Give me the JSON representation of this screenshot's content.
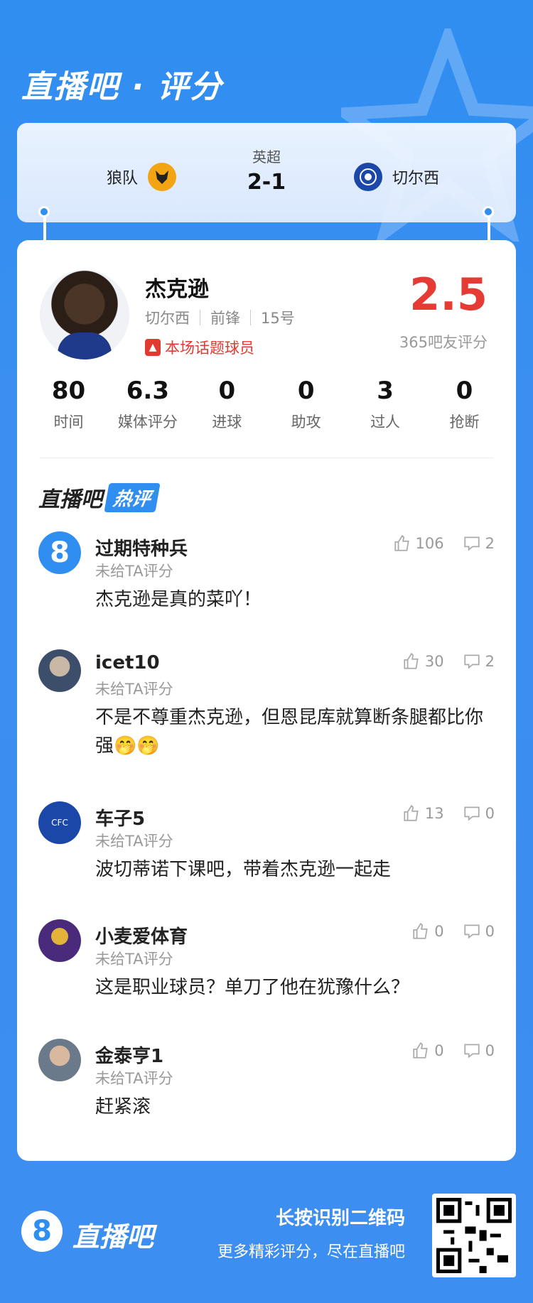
{
  "header": {
    "title": "直播吧 · 评分"
  },
  "match": {
    "league": "英超",
    "score": "2-1",
    "home": "狼队",
    "away": "切尔西",
    "home_badge": "wolves-badge-icon",
    "away_badge": "chelsea-badge-icon"
  },
  "player": {
    "name": "杰克逊",
    "club": "切尔西",
    "position": "前锋",
    "number": "15号",
    "tag": "本场话题球员",
    "rating": "2.5",
    "rating_label": "365吧友评分"
  },
  "stats": [
    {
      "value": "80",
      "label": "时间"
    },
    {
      "value": "6.3",
      "label": "媒体评分"
    },
    {
      "value": "0",
      "label": "进球"
    },
    {
      "value": "0",
      "label": "助攻"
    },
    {
      "value": "3",
      "label": "过人"
    },
    {
      "value": "0",
      "label": "抢断"
    }
  ],
  "hot_section": {
    "brand": "直播吧",
    "pill": "热评"
  },
  "comments": [
    {
      "user": "过期特种兵",
      "sub": "未给TA评分",
      "text": "杰克逊是真的菜吖！",
      "likes": "106",
      "replies": "2"
    },
    {
      "user": "icet10",
      "sub": "未给TA评分",
      "text": "不是不尊重杰克逊，但恩昆库就算断条腿都比你强🤭🤭",
      "likes": "30",
      "replies": "2"
    },
    {
      "user": "车子5",
      "sub": "未给TA评分",
      "text": "波切蒂诺下课吧，带着杰克逊一起走",
      "likes": "13",
      "replies": "0"
    },
    {
      "user": "小麦爱体育",
      "sub": "未给TA评分",
      "text": "这是职业球员？单刀了他在犹豫什么？",
      "likes": "0",
      "replies": "0"
    },
    {
      "user": "金泰亨1",
      "sub": "未给TA评分",
      "text": "赶紧滚",
      "likes": "0",
      "replies": "0"
    }
  ],
  "footer": {
    "logo_glyph": "8",
    "logo_text": "直播吧",
    "line1": "长按识别二维码",
    "line2": "更多精彩评分，尽在直播吧"
  },
  "colors": {
    "accent": "#2f8ef0",
    "rating": "#e53b34"
  }
}
